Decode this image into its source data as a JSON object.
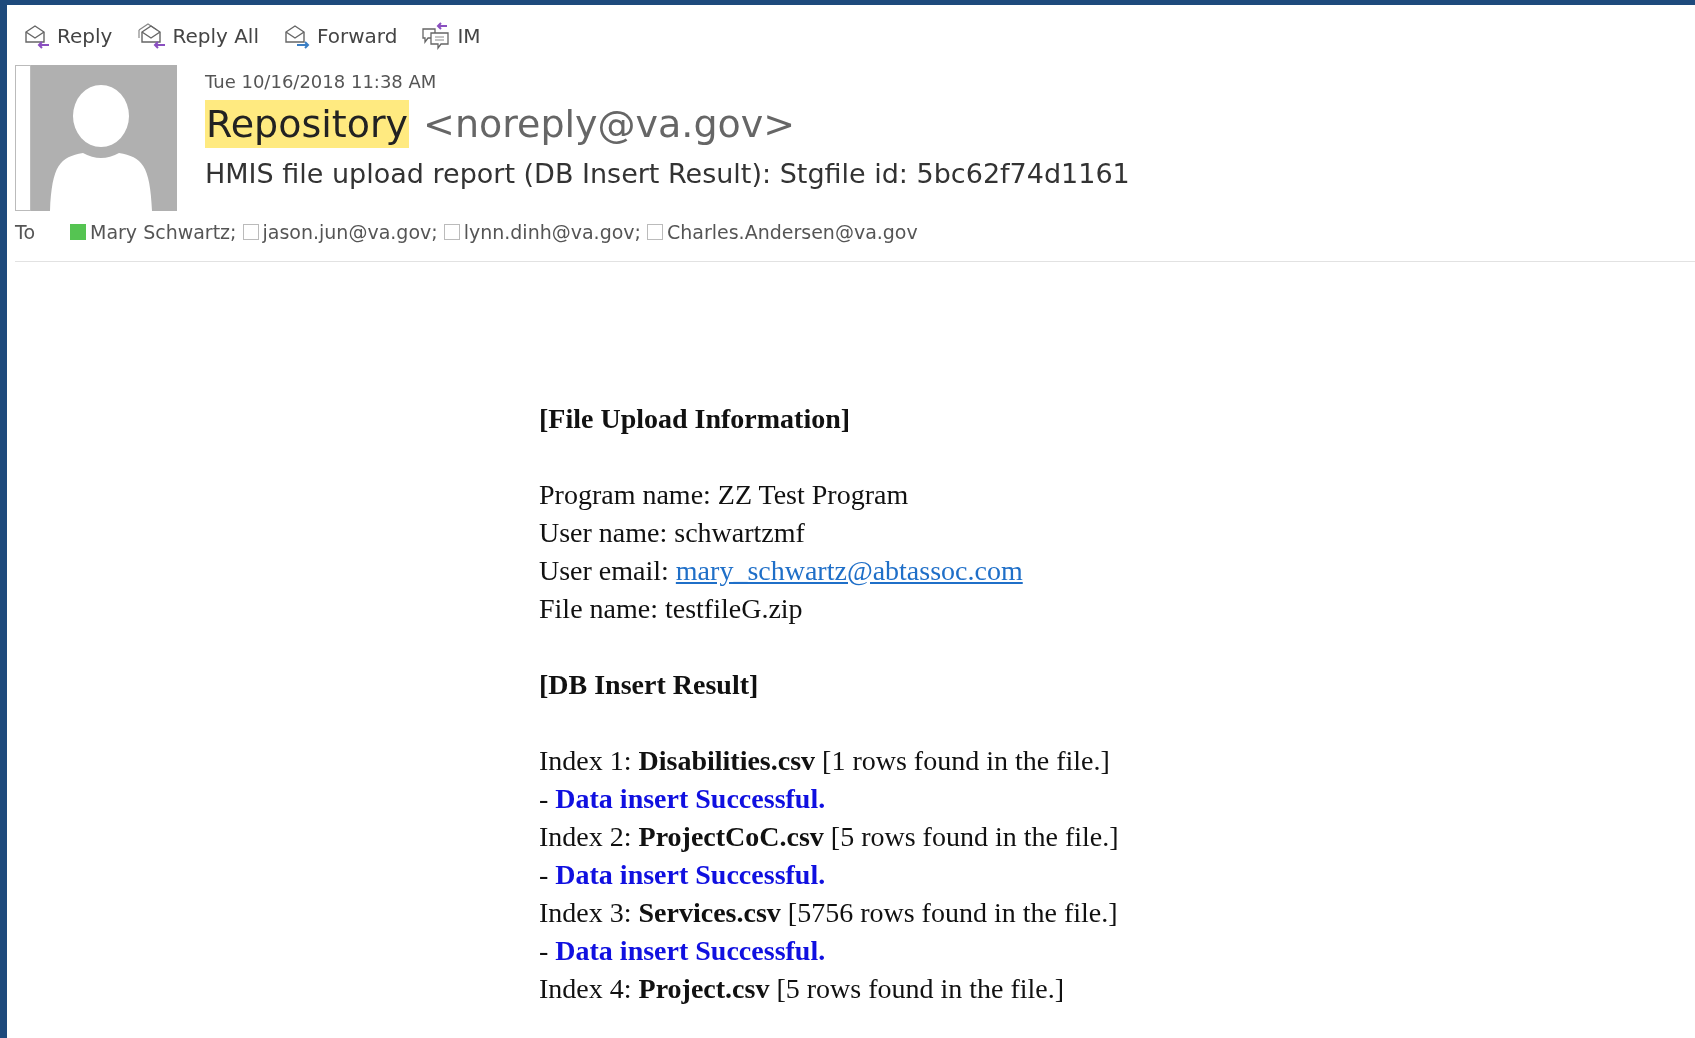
{
  "toolbar": [
    {
      "kind": "reply",
      "label": "Reply"
    },
    {
      "kind": "reply-all",
      "label": "Reply All"
    },
    {
      "kind": "forward",
      "label": "Forward"
    },
    {
      "kind": "im",
      "label": "IM"
    }
  ],
  "message": {
    "date": "Tue 10/16/2018 11:38 AM",
    "sender_name": "Repository",
    "sender_address": "<noreply@va.gov>",
    "subject": "HMIS file upload report (DB Insert Result): Stgfile id: 5bc62f74d1161",
    "to_label": "To",
    "recipients": [
      {
        "name": "Mary Schwartz;",
        "online": true
      },
      {
        "name": "jason.jun@va.gov;",
        "online": false
      },
      {
        "name": "lynn.dinh@va.gov;",
        "online": false
      },
      {
        "name": "Charles.Andersen@va.gov",
        "online": false
      }
    ]
  },
  "body": [
    {
      "kind": "heading",
      "text": "[File Upload Information]"
    },
    {
      "kind": "gap"
    },
    {
      "kind": "text",
      "text": "Program name: ZZ Test Program"
    },
    {
      "kind": "text",
      "text": "User name: schwartzmf"
    },
    {
      "kind": "link",
      "text": "User email: ",
      "link": "mary_schwartz@abtassoc.com"
    },
    {
      "kind": "text",
      "text": "File name: testfileG.zip"
    },
    {
      "kind": "gap"
    },
    {
      "kind": "heading",
      "text": "[DB Insert Result]"
    },
    {
      "kind": "gap"
    },
    {
      "kind": "text",
      "text": "Index 1: **Disabilities.csv** [1 rows found in the file.]"
    },
    {
      "kind": "result",
      "text": "- **Data insert Successful.**"
    },
    {
      "kind": "text",
      "text": "Index 2: **ProjectCoC.csv** [5 rows found in the file.]"
    },
    {
      "kind": "result",
      "text": "- **Data insert Successful.**"
    },
    {
      "kind": "text",
      "text": "Index 3: **Services.csv** [5756 rows found in the file.]"
    },
    {
      "kind": "result",
      "text": "- **Data insert Successful.**"
    },
    {
      "kind": "text",
      "text": "Index 4: **Project.csv** [5 rows found in the file.]"
    }
  ]
}
